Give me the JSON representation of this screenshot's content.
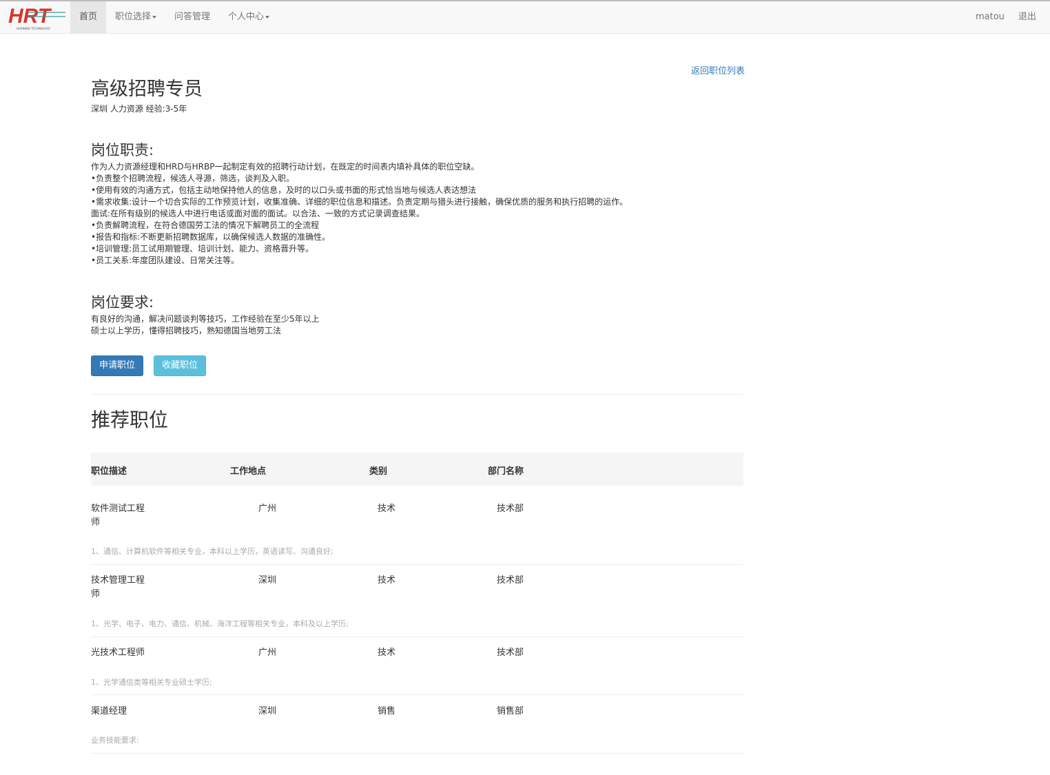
{
  "nav": {
    "logo_text": "HRT",
    "items": [
      "首页",
      "职位选择",
      "问答管理",
      "个人中心"
    ],
    "user": "matou",
    "logout": "退出"
  },
  "job": {
    "back_link": "返回职位列表",
    "title": "高级招聘专员",
    "meta": "深圳 人力资源 经验:3-5年",
    "duties_title": "岗位职责:",
    "duties": [
      "作为人力资源经理和HRD与HRBP一起制定有效的招聘行动计划，在既定的时间表内填补具体的职位空缺。",
      "•负责整个招聘流程，候选人寻源，筛选，谈判及入职。",
      "•使用有效的沟通方式，包括主动地保持他人的信息，及时的以口头或书面的形式恰当地与候选人表达想法",
      "•需求收集:设计一个切合实际的工作预览计划，收集准确、详细的职位信息和描述。负责定期与猎头进行接触，确保优质的服务和执行招聘的运作。",
      "面试:在所有级别的候选人中进行电话或面对面的面试。以合法、一致的方式记录调查结果。",
      "•负责解聘流程，在符合德国劳工法的情况下解聘员工的全流程",
      "•报告和指标:不断更新招聘数据库，以确保候选人数据的准确性。",
      "•培训管理:员工试用期管理、培训计划、能力、资格晋升等。",
      "•员工关系:年度团队建设、日常关注等。"
    ],
    "req_title": "岗位要求:",
    "requirements": [
      "有良好的沟通，解决问题谈判等技巧，工作经验在至少5年以上",
      "硕士以上学历，懂得招聘技巧，熟知德国当地劳工法"
    ],
    "apply": "申请职位",
    "favorite": "收藏职位"
  },
  "recommend": {
    "title": "推荐职位",
    "headers": [
      "职位描述",
      "工作地点",
      "类别",
      "部门名称"
    ],
    "rows": [
      {
        "name": "软件测试工程师",
        "city": "广州",
        "type": "技术",
        "dept": "技术部",
        "desc": "1、通信、计算机软件等相关专业，本科以上学历，英语读写、沟通良好;"
      },
      {
        "name": "技术管理工程师",
        "city": "深圳",
        "type": "技术",
        "dept": "技术部",
        "desc": "1、光学、电子、电力、通信、机械、海洋工程等相关专业，本科及以上学历;"
      },
      {
        "name": "光技术工程师",
        "city": "广州",
        "type": "技术",
        "dept": "技术部",
        "desc": "1、光学通信类等相关专业硕士学历;"
      },
      {
        "name": "渠道经理",
        "city": "深圳",
        "type": "销售",
        "dept": "销售部",
        "desc": "业务技能要求:"
      }
    ]
  },
  "colors": {
    "primary": "#337ab7",
    "info": "#5bc0de",
    "link": "#337ab7"
  }
}
